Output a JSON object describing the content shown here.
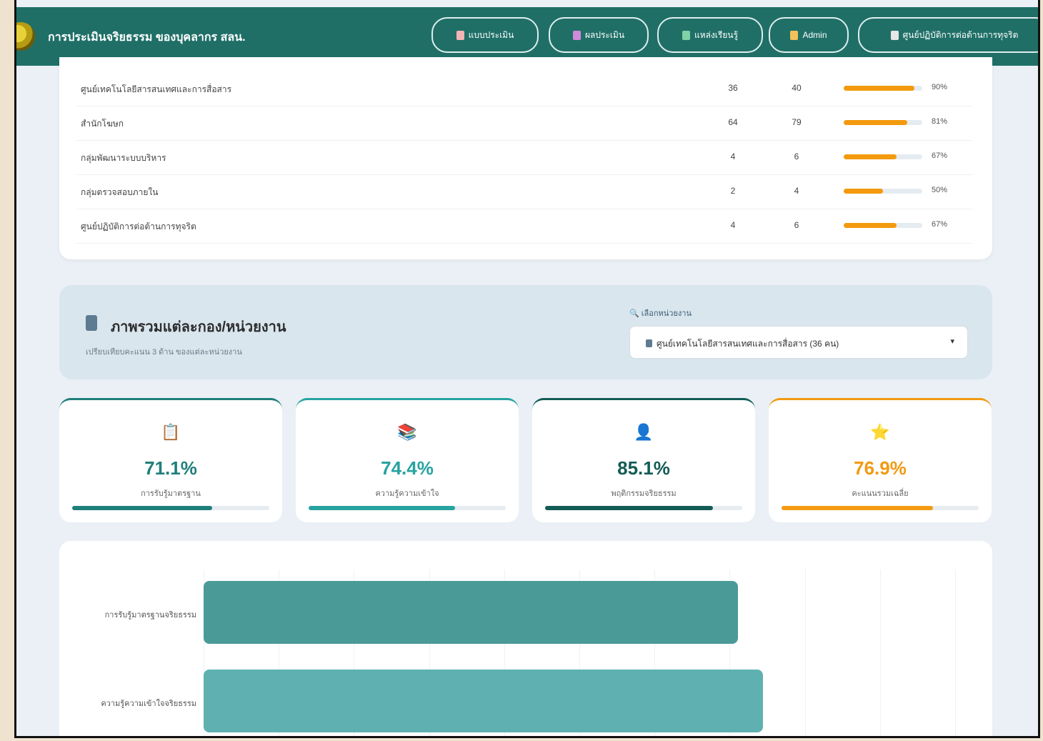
{
  "app": {
    "title": "การประเมินจริยธรรม ของบุคลากร สลน."
  },
  "nav": [
    {
      "label": "แบบประเมิน",
      "icon": "document-icon",
      "color": "#f5b4b4"
    },
    {
      "label": "ผลประเมิน",
      "icon": "chart-icon",
      "color": "#d18ad9"
    },
    {
      "label": "แหล่งเรียนรู้",
      "icon": "books-icon",
      "color": "#7fd1a6"
    },
    {
      "label": "Admin",
      "icon": "lock-icon",
      "color": "#f3c05a"
    },
    {
      "label": "ศูนย์ปฏิบัติการต่อต้านการทุจริต",
      "icon": "building-icon",
      "color": "#e6e6e6"
    }
  ],
  "table": {
    "rows": [
      {
        "name": "ศูนย์เทคโนโลยีสารสนเทศและการสื่อสาร",
        "a": "36",
        "b": "40",
        "pct": "90%",
        "ratio": 0.9
      },
      {
        "name": "สำนักโฆษก",
        "a": "64",
        "b": "79",
        "pct": "81%",
        "ratio": 0.81
      },
      {
        "name": "กลุ่มพัฒนาระบบบริหาร",
        "a": "4",
        "b": "6",
        "pct": "67%",
        "ratio": 0.67
      },
      {
        "name": "กลุ่มตรวจสอบภายใน",
        "a": "2",
        "b": "4",
        "pct": "50%",
        "ratio": 0.5
      },
      {
        "name": "ศูนย์ปฏิบัติการต่อต้านการทุจริต",
        "a": "4",
        "b": "6",
        "pct": "67%",
        "ratio": 0.67
      }
    ]
  },
  "overview": {
    "title": "ภาพรวมแต่ละกอง/หน่วยงาน",
    "subtitle": "เปรียบเทียบคะแนน 3 ด้าน ของแต่ละหน่วยงาน",
    "select_label": "เลือกหน่วยงาน",
    "selected": "ศูนย์เทคโนโลยีสารสนเทศและการสื่อสาร (36 คน)"
  },
  "stats": [
    {
      "value": "71.1%",
      "label": "การรับรู้มาตรฐาน",
      "ratio": 0.711,
      "color": "#1f7f7a",
      "icon": "clipboard-icon",
      "glyph": "📋"
    },
    {
      "value": "74.4%",
      "label": "ความรู้ความเข้าใจ",
      "ratio": 0.744,
      "color": "#27a3a0",
      "icon": "books-icon",
      "glyph": "📚"
    },
    {
      "value": "85.1%",
      "label": "พฤติกรรมจริยธรรม",
      "ratio": 0.851,
      "color": "#135c56",
      "icon": "person-icon",
      "glyph": "👤"
    },
    {
      "value": "76.9%",
      "label": "คะแนนรวมเฉลี่ย",
      "ratio": 0.769,
      "color": "#f29a12",
      "icon": "star-icon",
      "glyph": "⭐"
    }
  ],
  "chart_data": {
    "type": "bar",
    "orientation": "horizontal",
    "categories": [
      "การรับรู้มาตรฐานจริยธรรม",
      "ความรู้ความเข้าใจจริยธรรม"
    ],
    "values": [
      71.1,
      74.4
    ],
    "xlim": [
      0,
      100
    ],
    "colors": [
      "#4a9a98",
      "#5eb1b0"
    ]
  }
}
